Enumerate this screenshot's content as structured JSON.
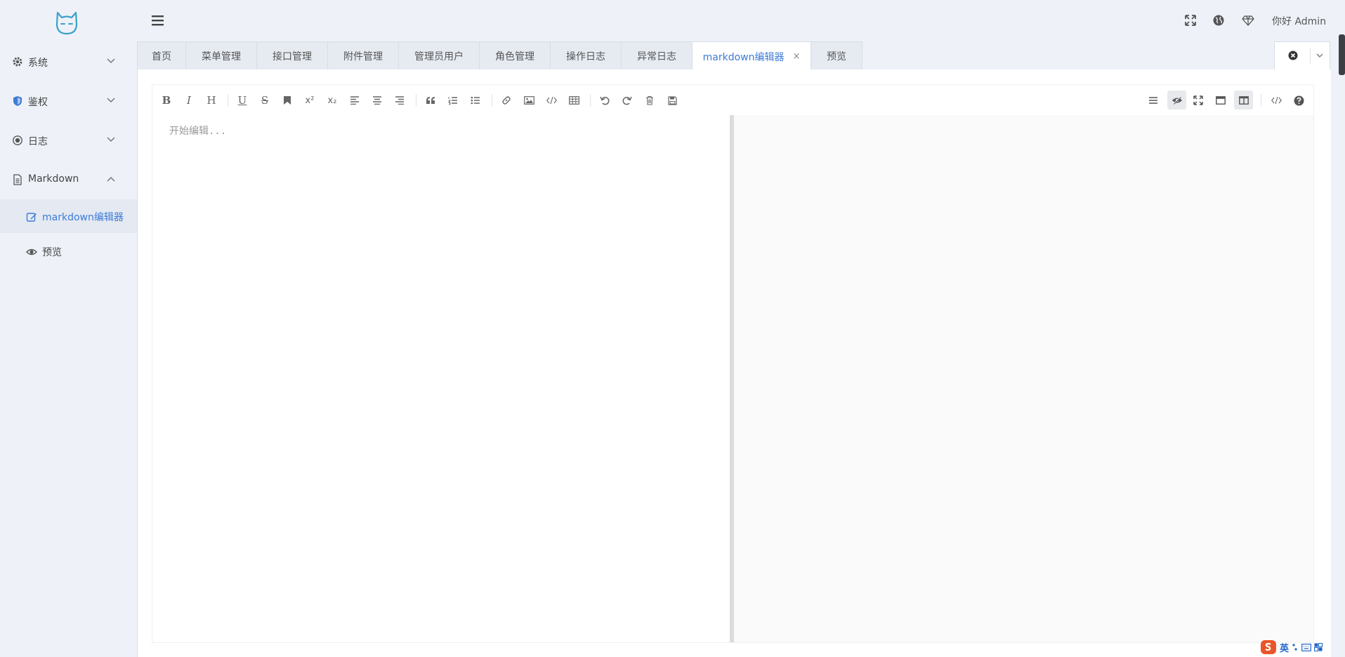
{
  "app": {
    "logo": "cat-logo-icon",
    "greeting": "你好 Admin"
  },
  "colors": {
    "accent": "#3e7bd6",
    "sidebar_bg": "#eef2f8",
    "logo": "#3aa0c8"
  },
  "sidebar": {
    "items": [
      {
        "label": "系统",
        "icon": "gear-icon",
        "expanded": false
      },
      {
        "label": "鉴权",
        "icon": "shield-icon",
        "expanded": false
      },
      {
        "label": "日志",
        "icon": "target-icon",
        "expanded": false
      },
      {
        "label": "Markdown",
        "icon": "file-text-icon",
        "expanded": true
      }
    ],
    "subitems": [
      {
        "label": "markdown编辑器",
        "icon": "edit-icon",
        "active": true
      },
      {
        "label": "预览",
        "icon": "eye-icon",
        "active": false
      }
    ]
  },
  "header": {
    "icons": [
      "fullscreen-icon",
      "globe-icon",
      "diamond-icon"
    ]
  },
  "tabs": [
    {
      "label": "首页"
    },
    {
      "label": "菜单管理"
    },
    {
      "label": "接口管理"
    },
    {
      "label": "附件管理"
    },
    {
      "label": "管理员用户"
    },
    {
      "label": "角色管理"
    },
    {
      "label": "操作日志"
    },
    {
      "label": "异常日志"
    },
    {
      "label": "markdown编辑器",
      "active": true,
      "close": "×"
    },
    {
      "label": "预览"
    }
  ],
  "editor": {
    "placeholder": "开始编辑...",
    "value": ""
  },
  "ime": {
    "label": "英"
  }
}
